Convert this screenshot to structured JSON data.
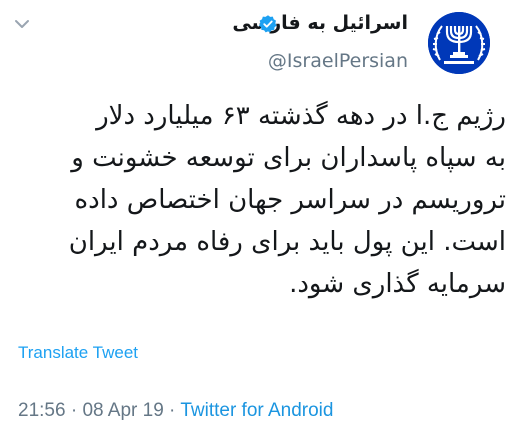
{
  "account": {
    "display_name": "اسرائیل به فارسی",
    "handle": "@IsraelPersian",
    "avatar": "israel-emblem-icon",
    "verified": true
  },
  "tweet": {
    "lines": [
      "رژیم ج.ا در دهه گذشته ۶۳ میلیارد دلار",
      "به سپاه پاسداران برای توسعه خشونت و",
      "تروریسم در سراسر جهان اختصاص داده",
      "است. این پول باید برای رفاه مردم ایران",
      "سرمایه گذاری شود."
    ]
  },
  "translate_label": "Translate Tweet",
  "meta": {
    "time": "21:56",
    "separator1": " · ",
    "date": "08 Apr 19",
    "separator2": " · ",
    "source": "Twitter for Android"
  },
  "colors": {
    "link": "#1da1f2",
    "muted": "#657786",
    "avatar_bg": "#0038b8"
  },
  "icons": {
    "menu": "chevron-down-icon",
    "verified": "verified-badge-icon"
  }
}
